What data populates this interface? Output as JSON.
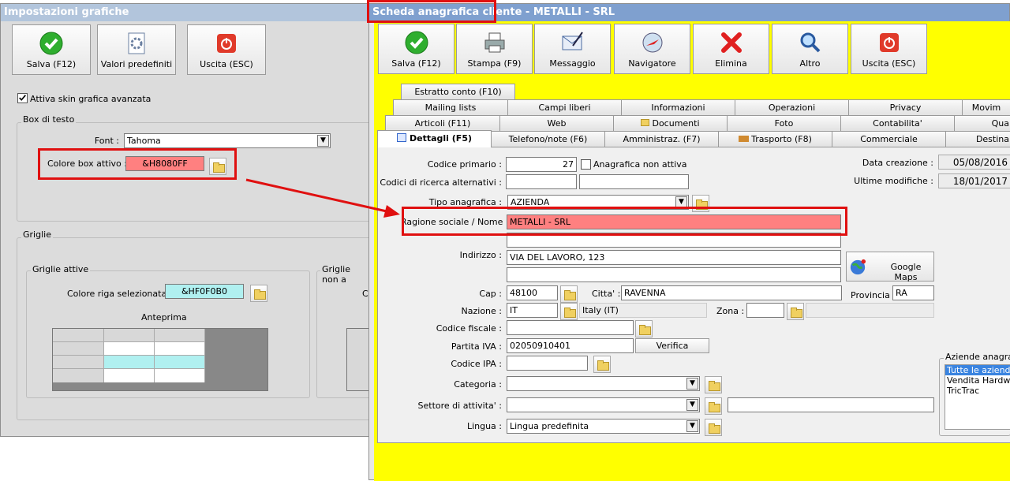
{
  "left": {
    "title": "Impostazioni grafiche",
    "toolbar": {
      "save": "Salva (F12)",
      "defaults": "Valori predefiniti",
      "exit": "Uscita (ESC)"
    },
    "skin_checkbox": "Attiva skin grafica avanzata",
    "textbox_group": "Box di testo",
    "font_label": "Font :",
    "font_value": "Tahoma",
    "active_color_label": "Colore box attivo :",
    "active_color_value": "&H8080FF",
    "grids_group": "Griglie",
    "active_grids": "Griglie attive",
    "sel_row_label": "Colore riga selezionata :",
    "sel_row_value": "&HF0F0B0",
    "preview": "Anteprima",
    "inactive_grids": "Griglie non a",
    "inactive_label_partial": "Co"
  },
  "right": {
    "title": "Scheda anagrafica cliente - METALLI - SRL",
    "toolbar": {
      "save": "Salva (F12)",
      "print": "Stampa (F9)",
      "message": "Messaggio",
      "navigator": "Navigatore",
      "delete": "Elimina",
      "other": "Altro",
      "exit": "Uscita (ESC)"
    },
    "tabs_row1": [
      "Estratto conto (F10)"
    ],
    "tabs_row2": [
      "Mailing lists",
      "Campi liberi",
      "Informazioni",
      "Operazioni",
      "Privacy",
      "Movim"
    ],
    "tabs_row3": [
      "Articoli (F11)",
      "Web",
      "Documenti",
      "Foto",
      "Contabilita'",
      "Qua"
    ],
    "tabs_row4": [
      "Dettagli (F5)",
      "Telefono/note (F6)",
      "Amministraz. (F7)",
      "Trasporto (F8)",
      "Commerciale",
      "Destina"
    ],
    "form": {
      "primary_code_label": "Codice primario :",
      "primary_code": "27",
      "inactive_label": "Anagrafica non attiva",
      "alt_codes_label": "Codici di ricerca alternativi :",
      "type_label": "Tipo anagrafica :",
      "type_value": "AZIENDA",
      "name_label": "Ragione sociale / Nome :",
      "name_value": "METALLI - SRL",
      "address_label": "Indirizzo :",
      "address_value": "VIA DEL LAVORO, 123",
      "maps_button": "Google Maps",
      "cap_label": "Cap :",
      "cap_value": "48100",
      "city_label": "Citta' :",
      "city_value": "RAVENNA",
      "province_label": "Provincia :",
      "province_value": "RA",
      "nation_label": "Nazione :",
      "nation_value": "IT",
      "nation_name": "Italy (IT)",
      "zone_label": "Zona :",
      "fiscal_label": "Codice fiscale :",
      "vat_label": "Partita IVA :",
      "vat_value": "02050910401",
      "verify_button": "Verifica",
      "ipa_label": "Codice IPA :",
      "category_label": "Categoria :",
      "sector_label": "Settore di attivita' :",
      "language_label": "Lingua :",
      "language_value": "Lingua predefinita",
      "created_label": "Data creazione :",
      "created_value": "05/08/2016",
      "modified_label": "Ultime modifiche :",
      "modified_value": "18/01/2017",
      "companies_label": "Aziende anagrafic",
      "companies": [
        "Tutte le aziende",
        "Vendita Hardwar",
        "TricTrac"
      ]
    }
  },
  "colors": {
    "active_box": "#ff8080",
    "selected_row": "#b0f0f0",
    "yellow_bg": "#ffff00",
    "annotation": "#e01010"
  }
}
